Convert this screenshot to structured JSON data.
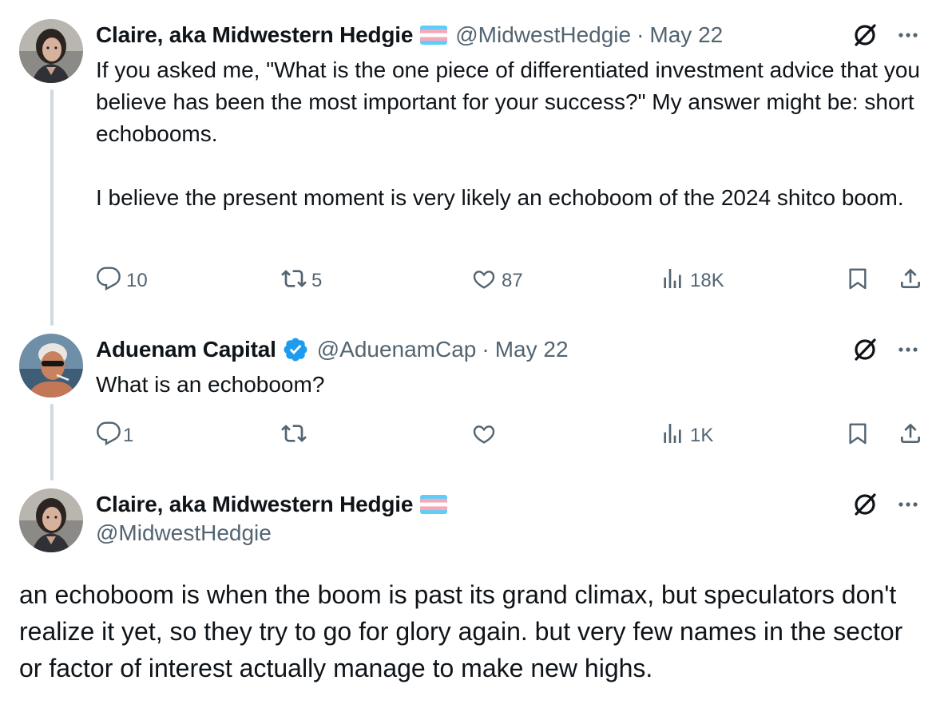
{
  "tweets": [
    {
      "author": "Claire, aka Midwestern Hedgie",
      "handle": "@MidwestHedgie",
      "separator": "·",
      "date": "May 22",
      "text": "If you asked me, \"What is the one piece of differentiated investment advice that you believe has been the most important for your success?\" My answer might be: short echobooms.\n\nI believe the present moment is very likely an echoboom of the 2024 shitco boom.",
      "stats": {
        "replies": "10",
        "reposts": "5",
        "likes": "87",
        "views": "18K"
      }
    },
    {
      "author": "Aduenam Capital",
      "handle": "@AduenamCap",
      "separator": "·",
      "date": "May 22",
      "text": "What is an echoboom?",
      "stats": {
        "replies": "1",
        "reposts": "",
        "likes": "",
        "views": "1K"
      }
    },
    {
      "author": "Claire, aka Midwestern Hedgie",
      "handle": "@MidwestHedgie",
      "text": "an echoboom is when the boom is past its grand climax, but speculators don't realize it yet, so they try to go for glory again. but very few names in the sector or factor of interest actually manage to make new highs."
    }
  ],
  "icons": {
    "flag": "transgender-flag-icon",
    "verified": "verified-badge-icon",
    "grok": "grok-icon",
    "more": "more-icon",
    "reply": "reply-icon",
    "repost": "repost-icon",
    "like": "like-icon",
    "views": "views-icon",
    "bookmark": "bookmark-icon",
    "share": "share-icon"
  },
  "colors": {
    "text": "#0f1419",
    "secondary": "#536471",
    "verified": "#1d9bf0",
    "thread_line": "#cfd9de"
  }
}
